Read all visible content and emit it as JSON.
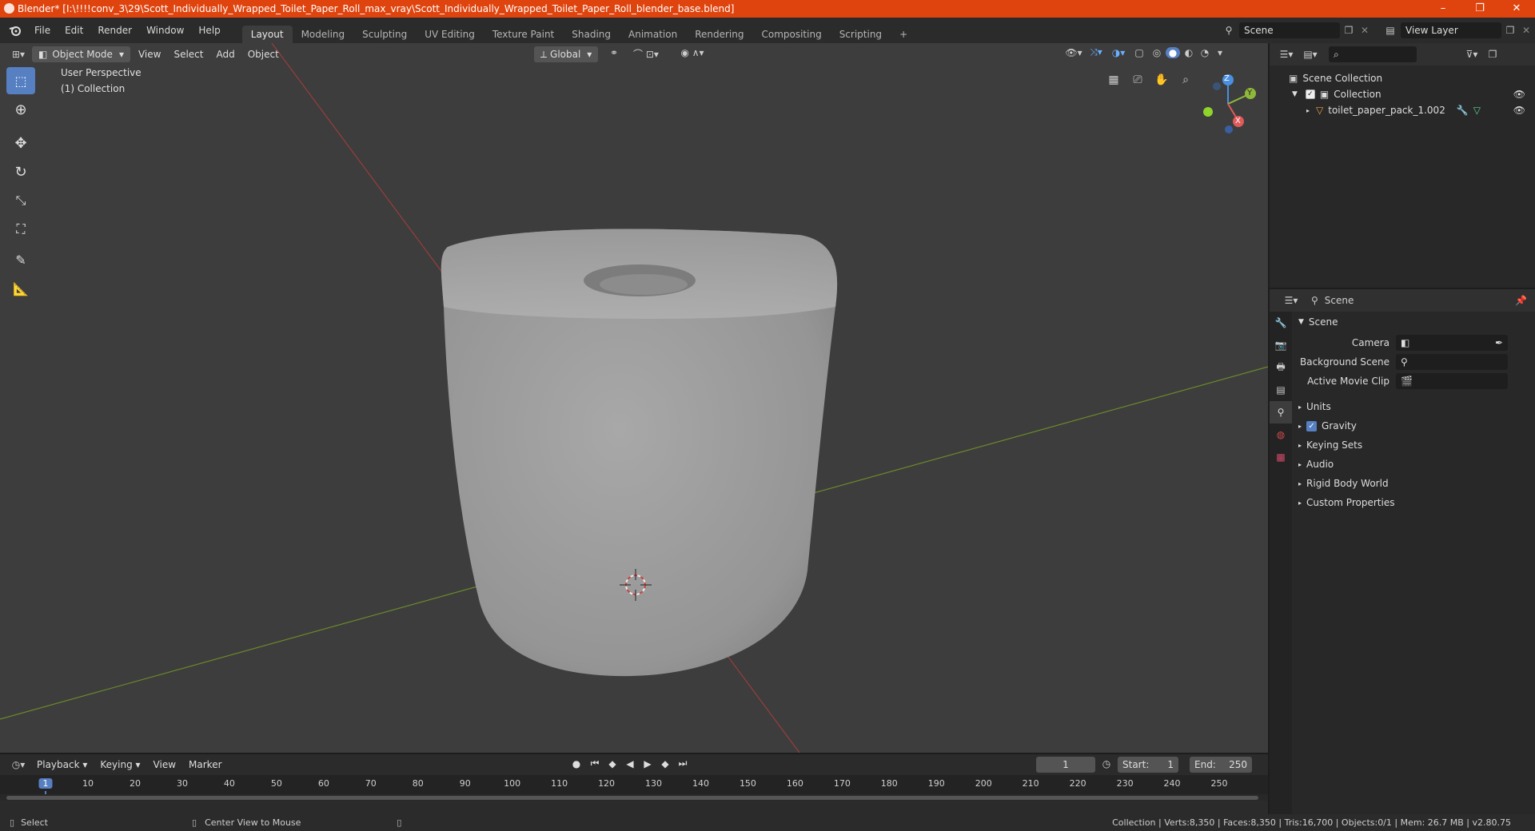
{
  "window": {
    "title": "Blender* [I:\\!!!!conv_3\\29\\Scott_Individually_Wrapped_Toilet_Paper_Roll_max_vray\\Scott_Individually_Wrapped_Toilet_Paper_Roll_blender_base.blend]",
    "minimize": "–",
    "maximize": "❐",
    "close": "✕"
  },
  "menu": {
    "items": [
      "File",
      "Edit",
      "Render",
      "Window",
      "Help"
    ],
    "workspaces": [
      "Layout",
      "Modeling",
      "Sculpting",
      "UV Editing",
      "Texture Paint",
      "Shading",
      "Animation",
      "Rendering",
      "Compositing",
      "Scripting"
    ],
    "active_workspace": "Layout",
    "add_workspace": "+",
    "scene_name": "Scene",
    "view_layer": "View Layer"
  },
  "viewport": {
    "mode": "Object Mode",
    "menus": [
      "View",
      "Select",
      "Add",
      "Object"
    ],
    "orientation": "Global",
    "perspective_label": "User Perspective",
    "collection_label": "(1) Collection",
    "gizmo_axes": {
      "x": "X",
      "y": "Y",
      "z": "Z"
    }
  },
  "outliner": {
    "root": "Scene Collection",
    "collection": "Collection",
    "object": "toilet_paper_pack_1.002"
  },
  "properties": {
    "context": "Scene",
    "panel_title": "Scene",
    "fields": {
      "camera": "Camera",
      "background_scene": "Background Scene",
      "active_movie_clip": "Active Movie Clip"
    },
    "panels": [
      "Units",
      "Gravity",
      "Keying Sets",
      "Audio",
      "Rigid Body World",
      "Custom Properties"
    ],
    "gravity_checked": true
  },
  "timeline": {
    "menus": [
      "Playback",
      "Keying",
      "View",
      "Marker"
    ],
    "current_frame": "1",
    "start_label": "Start:",
    "start": "1",
    "end_label": "End:",
    "end": "250",
    "ruler": [
      "1",
      "10",
      "20",
      "30",
      "40",
      "50",
      "60",
      "70",
      "80",
      "90",
      "100",
      "110",
      "120",
      "130",
      "140",
      "150",
      "160",
      "170",
      "180",
      "190",
      "200",
      "210",
      "220",
      "230",
      "240",
      "250"
    ]
  },
  "status": {
    "select": "Select",
    "center_view": "Center View to Mouse",
    "stats": "Collection | Verts:8,350 | Faces:8,350 | Tris:16,700 | Objects:0/1 | Mem: 26.7 MB | v2.80.75"
  },
  "colors": {
    "titlebar": "#e0440e",
    "accent_blue": "#5680c2",
    "axis_x": "#e05a5a",
    "axis_y": "#8fb83a",
    "axis_z": "#4a8fe0"
  }
}
